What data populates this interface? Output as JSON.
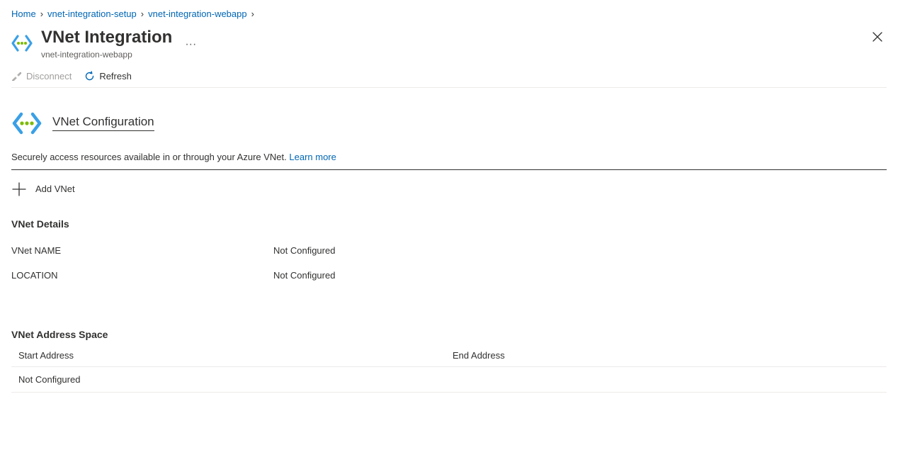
{
  "breadcrumb": {
    "items": [
      {
        "label": "Home"
      },
      {
        "label": "vnet-integration-setup"
      },
      {
        "label": "vnet-integration-webapp"
      }
    ]
  },
  "header": {
    "title": "VNet Integration",
    "subtitle": "vnet-integration-webapp"
  },
  "toolbar": {
    "disconnect_label": "Disconnect",
    "refresh_label": "Refresh"
  },
  "config": {
    "section_title": "VNet Configuration",
    "description": "Securely access resources available in or through your Azure VNet. ",
    "learn_more": "Learn more",
    "add_vnet_label": "Add VNet",
    "details_heading": "VNet Details",
    "rows": [
      {
        "label": "VNet NAME",
        "value": "Not Configured"
      },
      {
        "label": "LOCATION",
        "value": "Not Configured"
      }
    ],
    "address_heading": "VNet Address Space",
    "table": {
      "col_start": "Start Address",
      "col_end": "End Address",
      "rows": [
        {
          "start": "Not Configured",
          "end": ""
        }
      ]
    }
  }
}
